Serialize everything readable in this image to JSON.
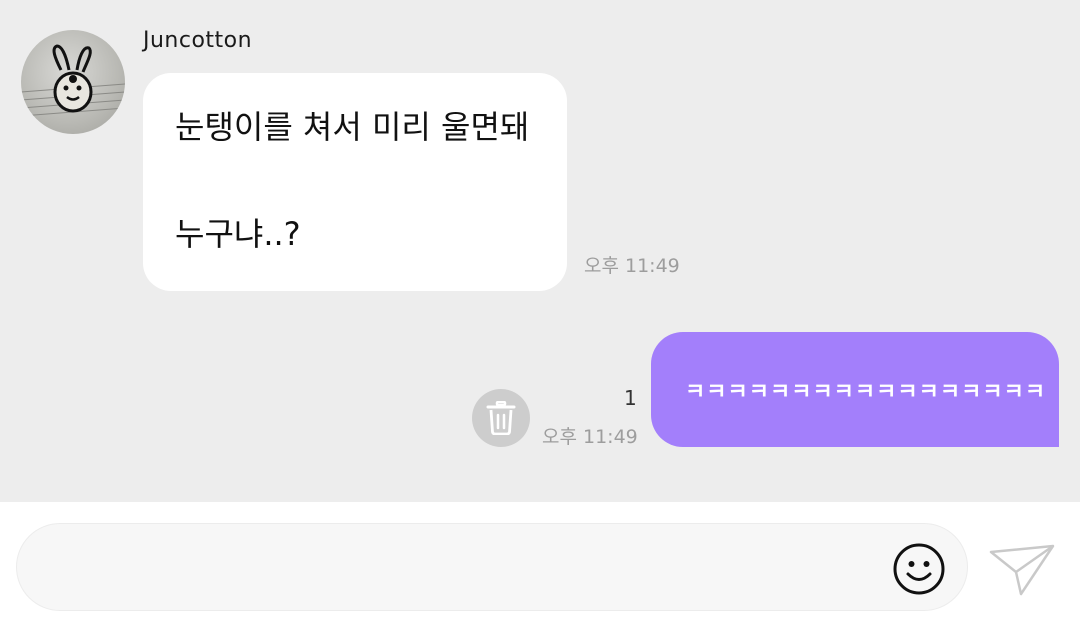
{
  "conversation": {
    "incoming": {
      "sender_name": "Juncotton",
      "avatar_icon": "bunny-avatar",
      "lines": [
        "눈탱이를 쳐서 미리 울면돼",
        "누구냐..?"
      ],
      "time": "오후 11:49"
    },
    "outgoing": {
      "text": "ㅋㅋㅋㅋㅋㅋㅋㅋㅋㅋㅋㅋㅋㅋㅋㅋㅋ",
      "unread_count": "1",
      "time": "오후 11:49",
      "bubble_color": "#a37ffb",
      "delete_icon": "trash-icon"
    }
  },
  "composer": {
    "value": "",
    "emoji_icon": "smiley-icon",
    "send_icon": "paper-plane-icon"
  },
  "colors": {
    "background": "#ededed",
    "incoming_bubble": "#ffffff",
    "outgoing_bubble": "#a37ffb",
    "timestamp": "#9d9d9d"
  }
}
